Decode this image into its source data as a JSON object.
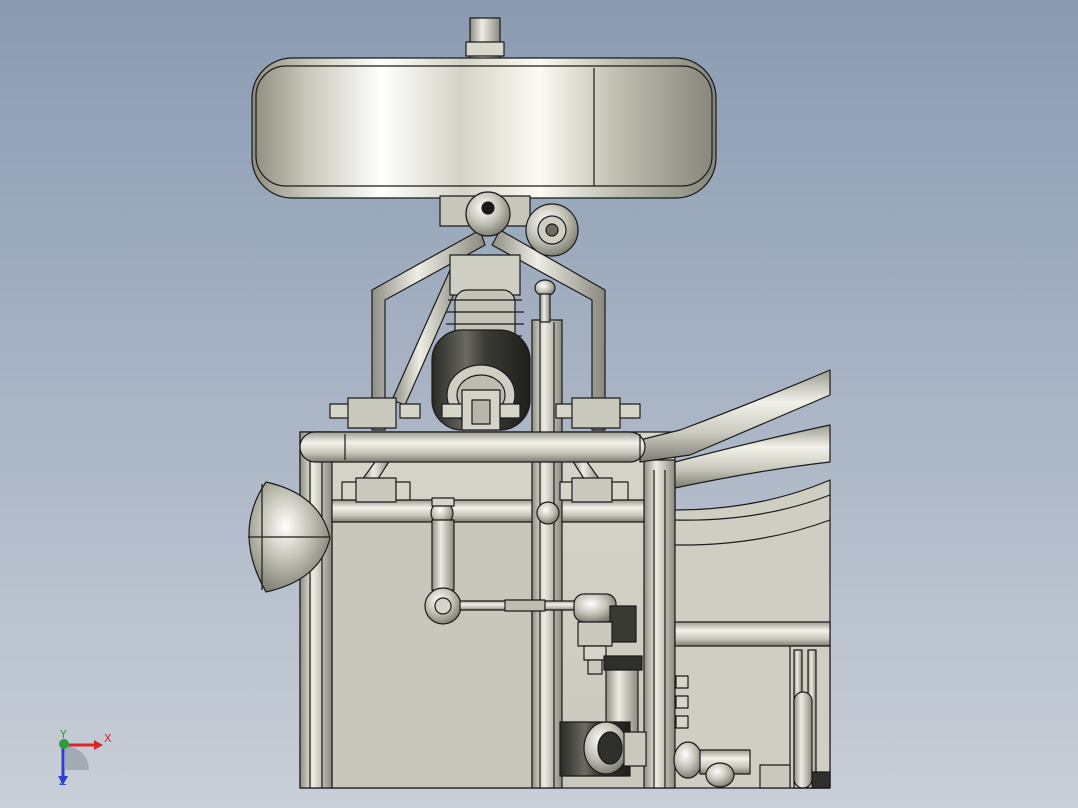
{
  "viewport": {
    "background_top": "#8a9bb2",
    "background_bottom": "#c9cfd8",
    "part_color": "#d2d1c6",
    "edge_color": "#1a1a1a"
  },
  "triad": {
    "x_label": "X",
    "y_label": "Y",
    "z_label": "Z",
    "x_color": "#d8272a",
    "y_color": "#2a9f3a",
    "z_color": "#2b3fd0"
  }
}
